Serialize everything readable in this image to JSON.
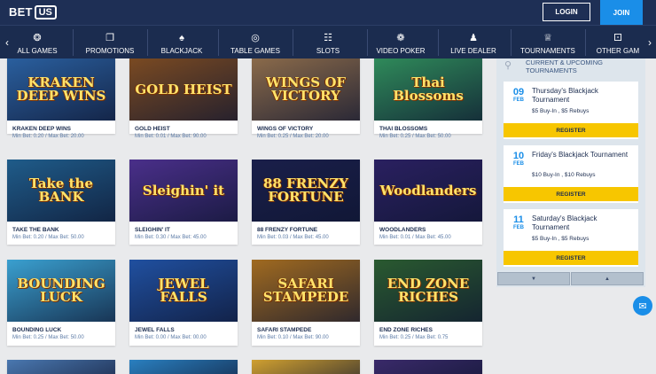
{
  "header": {
    "logo_text": "BET",
    "logo_box": "US",
    "login_label": "LOGIN",
    "join_label": "JOIN"
  },
  "nav": {
    "items": [
      {
        "label": "ALL GAMES",
        "icon": "poker-chip-icon",
        "glyph": "❂"
      },
      {
        "label": "PROMOTIONS",
        "icon": "gift-icon",
        "glyph": "❐"
      },
      {
        "label": "BLACKJACK",
        "icon": "playing-card-icon",
        "glyph": "♠"
      },
      {
        "label": "TABLE GAMES",
        "icon": "roulette-icon",
        "glyph": "◎"
      },
      {
        "label": "SLOTS",
        "icon": "slot-machine-icon",
        "glyph": "☷"
      },
      {
        "label": "VIDEO POKER",
        "icon": "chip-icon",
        "glyph": "❁"
      },
      {
        "label": "LIVE DEALER",
        "icon": "dealer-icon",
        "glyph": "♟"
      },
      {
        "label": "TOURNAMENTS",
        "icon": "trophy-icon",
        "glyph": "♕"
      },
      {
        "label": "OTHER GAM",
        "icon": "dice-icon",
        "glyph": "⚀"
      }
    ]
  },
  "games": [
    {
      "name": "KRAKEN DEEP WINS",
      "bet": "Min Bet: 0.20 / Max Bet: 20.00",
      "art": "KRAKEN DEEP WINS",
      "bg": "#2a5f9e"
    },
    {
      "name": "GOLD HEIST",
      "bet": "Min Bet: 0.01 / Max Bet: 90.00",
      "art": "GOLD HEIST",
      "bg": "#7a4a22"
    },
    {
      "name": "WINGS OF VICTORY",
      "bet": "Min Bet: 0.25 / Max Bet: 20.00",
      "art": "WINGS OF VICTORY",
      "bg": "#8a6a4a"
    },
    {
      "name": "THAI BLOSSOMS",
      "bet": "Min Bet: 0.25 / Max Bet: 50.00",
      "art": "Thai Blossoms",
      "bg": "#2f8a5a"
    },
    {
      "name": "TAKE THE BANK",
      "bet": "Min Bet: 0.20 / Max Bet: 50.00",
      "art": "Take the BANK",
      "bg": "#1f5c8a"
    },
    {
      "name": "SLEIGHIN' IT",
      "bet": "Min Bet: 0.30 / Max Bet: 45.00",
      "art": "Sleighin' it",
      "bg": "#4a2f8a"
    },
    {
      "name": "88 FRENZY FORTUNE",
      "bet": "Min Bet: 0.03 / Max Bet: 45.00",
      "art": "88 FRENZY FORTUNE",
      "bg": "#1a1f4a"
    },
    {
      "name": "WOODLANDERS",
      "bet": "Min Bet: 0.01 / Max Bet: 45.00",
      "art": "Woodlanders",
      "bg": "#2a2060"
    },
    {
      "name": "BOUNDING LUCK",
      "bet": "Min Bet: 0.25 / Max Bet: 50.00",
      "art": "BOUNDING LUCK",
      "bg": "#3aa0d0"
    },
    {
      "name": "JEWEL FALLS",
      "bet": "Min Bet: 0.00 / Max Bet: 00.00",
      "art": "JEWEL FALLS",
      "bg": "#2050a0"
    },
    {
      "name": "SAFARI STAMPEDE",
      "bet": "Min Bet: 0.10 / Max Bet: 90.00",
      "art": "SAFARI STAMPEDE",
      "bg": "#a06a20"
    },
    {
      "name": "END ZONE RICHES",
      "bet": "Min Bet: 0.25 / Max Bet: 0.75",
      "art": "END ZONE RICHES",
      "bg": "#2a5a30"
    },
    {
      "name": "",
      "bet": "",
      "art": "",
      "bg": "#4a78b0"
    },
    {
      "name": "",
      "bet": "",
      "art": "",
      "bg": "#2a80c0"
    },
    {
      "name": "",
      "bet": "",
      "art": "",
      "bg": "#d0a030"
    },
    {
      "name": "",
      "bet": "",
      "art": "",
      "bg": "#3a2a6a"
    }
  ],
  "sidebar": {
    "title": "CURRENT & UPCOMING TOURNAMENTS",
    "tournaments": [
      {
        "day": "09",
        "month": "FEB",
        "name": "Thursday's Blackjack Tournament",
        "buyin": "$5 Buy-In , $5 Rebuys",
        "register": "REGISTER"
      },
      {
        "day": "10",
        "month": "FEB",
        "name": "Friday's Blackjack Tournament",
        "buyin": "$10 Buy-In , $10 Rebuys",
        "register": "REGISTER"
      },
      {
        "day": "11",
        "month": "FEB",
        "name": "Saturday's Blackjack Tournament",
        "buyin": "$5 Buy-In , $5 Rebuys",
        "register": "REGISTER"
      }
    ],
    "prev_glyph": "▼",
    "next_glyph": "▲"
  },
  "colors": {
    "header_bg": "#1e2f55",
    "nav_bg": "#1b2c4f",
    "accent_blue": "#1a8ee8",
    "register_yellow": "#f7c600"
  }
}
